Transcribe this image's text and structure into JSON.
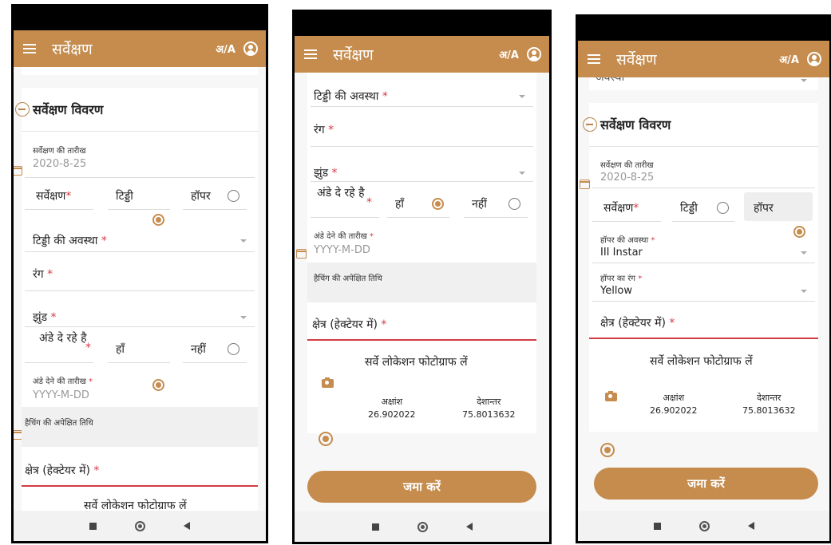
{
  "app": {
    "title": "सर्वेक्षण",
    "lang_toggle": "अ/A"
  },
  "card": {
    "title": "सर्वेक्षण विवरण"
  },
  "survey_date": {
    "label": "सर्वेक्षण की तारीख",
    "value": "2020-8-25"
  },
  "survey_type": {
    "label": "सर्वेक्षण",
    "option_locust": "टिड्डी",
    "option_hopper": "हॉपर"
  },
  "locust_stage": {
    "label": "टिड्डी की अवस्था"
  },
  "color": {
    "label": "रंग"
  },
  "swarm": {
    "label": "झुंड"
  },
  "egg_laying": {
    "label": "अंडे दे रहे है",
    "yes": "हाँ",
    "no": "नहीं"
  },
  "egg_date": {
    "label": "अंडे देने की तारीख",
    "placeholder": "YYYY-M-DD"
  },
  "hatching": {
    "label": "हैचिंग की अपेक्षित तिथि"
  },
  "area": {
    "label": "क्षेत्र (हेक्टेयर में)"
  },
  "photo": {
    "label": "सर्वे लोकेशन फोटोग्राफ लें"
  },
  "location": {
    "lat_label": "अक्षांश",
    "lat_value": "26.902022",
    "lon_label": "देशान्तर",
    "lon_value": "75.8013632"
  },
  "hopper_stage": {
    "label": "हॉपर की अवस्था",
    "value": "III Instar"
  },
  "hopper_color": {
    "label": "हॉपर का रंग",
    "value": "Yellow"
  },
  "top_cutoff_text": "अवस्था",
  "submit": {
    "label": "जमा करें"
  },
  "required_mark": "*",
  "colors": {
    "accent": "#c58c4e",
    "error": "#d23b45"
  }
}
